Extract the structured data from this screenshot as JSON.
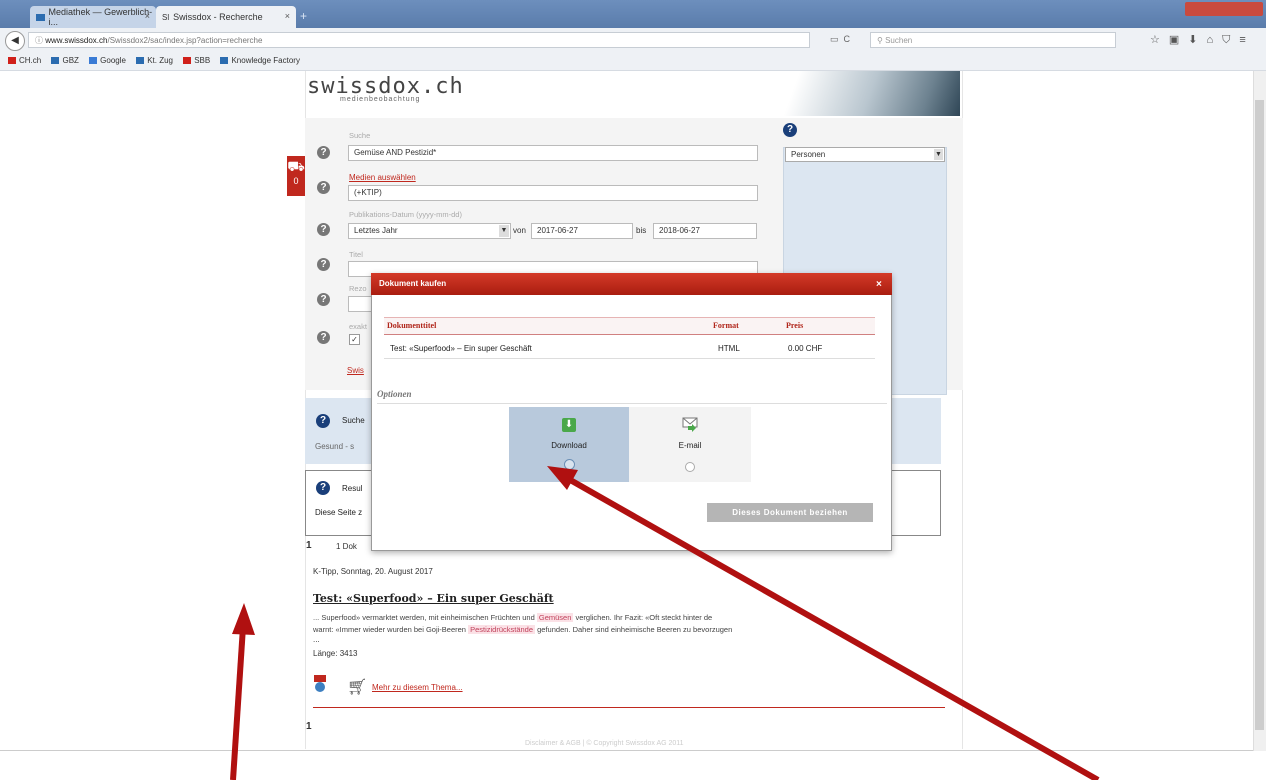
{
  "browser": {
    "tabs": [
      {
        "label": "Mediathek — Gewerblich-i..."
      },
      {
        "label": "Swissdox - Recherche"
      }
    ],
    "tab2_favicon": "Sl",
    "url_domain": "www.swissdox.ch",
    "url_path": "/Swissdox2/sac/index.jsp?action=recherche",
    "search_placeholder": "Suchen",
    "bookmarks": [
      {
        "label": "CH.ch",
        "color": "#d0201a"
      },
      {
        "label": "GBZ",
        "color": "#2b6cb0"
      },
      {
        "label": "Google",
        "color": "#3a7bd5"
      },
      {
        "label": "Kt. Zug",
        "color": "#2b6cb0"
      },
      {
        "label": "SBB",
        "color": "#d0201a"
      },
      {
        "label": "Knowledge Factory",
        "color": "#2b6cb0"
      }
    ]
  },
  "site": {
    "logo": "swissdox.ch",
    "logo_sub": "medienbeobachtung",
    "cart_count": "0",
    "accent": "#c0281e"
  },
  "form": {
    "suche_label": "Suche",
    "suche_value": "Gemüse AND Pestizid*",
    "medien_link": "Medien auswählen",
    "medien_value": "(+KTIP)",
    "datum_label": "Publikations-Datum (yyyy-mm-dd)",
    "datum_select": "Letztes Jahr",
    "von_label": "von",
    "von_value": "2017-06-27",
    "bis_label": "bis",
    "bis_value": "2018-06-27",
    "titel_label": "Titel",
    "rezo_label": "Rezo",
    "exakt_label": "exakt",
    "link_partial": "Swis",
    "personen_select": "Personen"
  },
  "suche_box": {
    "label": "Suche",
    "tags": "Gesund  -  s"
  },
  "result_box": {
    "label": "Resul",
    "text": "Diese Seite z"
  },
  "results": {
    "page_line_num": "1",
    "page_line_text": "1 Dok",
    "source_date": "K-Tipp, Sonntag, 20. August 2017",
    "title": "Test: «Superfood» – Ein super Geschäft",
    "snippet1_a": "... Superfood» vermarktet werden, mit einheimischen Früchten und",
    "snippet1_hl": "Gemüsen",
    "snippet1_b": "verglichen. Ihr Fazit: «Oft steckt hinter de",
    "snippet2_a": "warnt: «Immer wieder wurden bei Goji-Beeren",
    "snippet2_hl": "Pestizidrückstände",
    "snippet2_b": "gefunden. Daher sind einheimische Beeren zu bevorzugen",
    "ellipsis": "...",
    "length": "Länge: 3413",
    "more_link": "Mehr zu diesem Thema...",
    "bottom_page": "1",
    "footer": "Disclaimer & AGB  |  © Copyright Swissdox AG 2011"
  },
  "modal": {
    "title": "Dokument kaufen",
    "close": "×",
    "col_title": "Dokumenttitel",
    "col_format": "Format",
    "col_price": "Preis",
    "row_title": "Test: «Superfood» – Ein super Geschäft",
    "row_format": "HTML",
    "row_price": "0.00 CHF",
    "optionen": "Optionen",
    "opt_download": "Download",
    "opt_email": "E-mail",
    "buy_button": "Dieses Dokument beziehen"
  },
  "annotation": {
    "arrow_color": "#b01010"
  }
}
